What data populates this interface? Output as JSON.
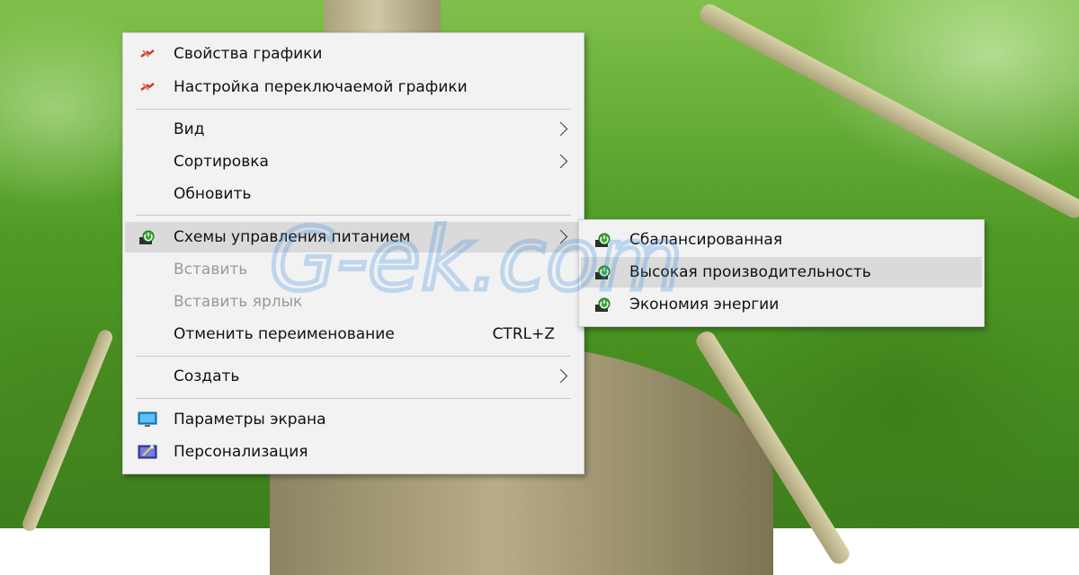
{
  "context_menu": {
    "items": [
      {
        "label": "Свойства графики",
        "icon": "amd-graphics-icon"
      },
      {
        "label": "Настройка переключаемой графики",
        "icon": "amd-graphics-icon"
      },
      {
        "label": "Вид",
        "submenu": true
      },
      {
        "label": "Сортировка",
        "submenu": true
      },
      {
        "label": "Обновить"
      },
      {
        "label": "Схемы управления питанием",
        "icon": "power-plan-icon",
        "submenu": true,
        "highlighted": true
      },
      {
        "label": "Вставить",
        "disabled": true
      },
      {
        "label": "Вставить ярлык",
        "disabled": true
      },
      {
        "label": "Отменить переименование",
        "shortcut": "CTRL+Z"
      },
      {
        "label": "Создать",
        "submenu": true
      },
      {
        "label": "Параметры экрана",
        "icon": "display-settings-icon"
      },
      {
        "label": "Персонализация",
        "icon": "personalization-icon"
      }
    ]
  },
  "power_submenu": {
    "items": [
      {
        "label": "Сбалансированная",
        "icon": "power-plan-icon"
      },
      {
        "label": "Высокая производительность",
        "icon": "power-plan-icon",
        "highlighted": true
      },
      {
        "label": "Экономия энергии",
        "icon": "power-plan-icon"
      }
    ]
  },
  "watermark": {
    "text": "G-ek.com"
  },
  "colors": {
    "menu_bg": "#f2f2f2",
    "hover_bg": "#dadada",
    "disabled_text": "#9a9a9a",
    "watermark": "#3a8ee6"
  }
}
